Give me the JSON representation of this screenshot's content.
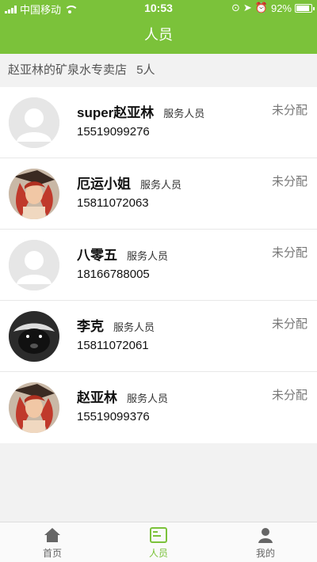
{
  "status_bar": {
    "carrier": "中国移动",
    "time": "10:53",
    "battery": "92%",
    "battery_level": 0.92
  },
  "header": {
    "title": "人员"
  },
  "store": {
    "name": "赵亚林的矿泉水专卖店",
    "count": "5人"
  },
  "staff": [
    {
      "name": "super赵亚林",
      "role": "服务人员",
      "phone": "15519099276",
      "status": "未分配",
      "avatar": "default"
    },
    {
      "name": "厄运小姐",
      "role": "服务人员",
      "phone": "15811072063",
      "status": "未分配",
      "avatar": "redhair"
    },
    {
      "name": "八零五",
      "role": "服务人员",
      "phone": "18166788005",
      "status": "未分配",
      "avatar": "default"
    },
    {
      "name": "李克",
      "role": "服务人员",
      "phone": "15811072061",
      "status": "未分配",
      "avatar": "badger"
    },
    {
      "name": "赵亚林",
      "role": "服务人员",
      "phone": "15519099376",
      "status": "未分配",
      "avatar": "redhair"
    }
  ],
  "tabs": [
    {
      "label": "首页",
      "icon": "home-icon",
      "active": false
    },
    {
      "label": "人员",
      "icon": "people-icon",
      "active": true
    },
    {
      "label": "我的",
      "icon": "profile-icon",
      "active": false
    }
  ],
  "colors": {
    "accent": "#7bc23a"
  }
}
